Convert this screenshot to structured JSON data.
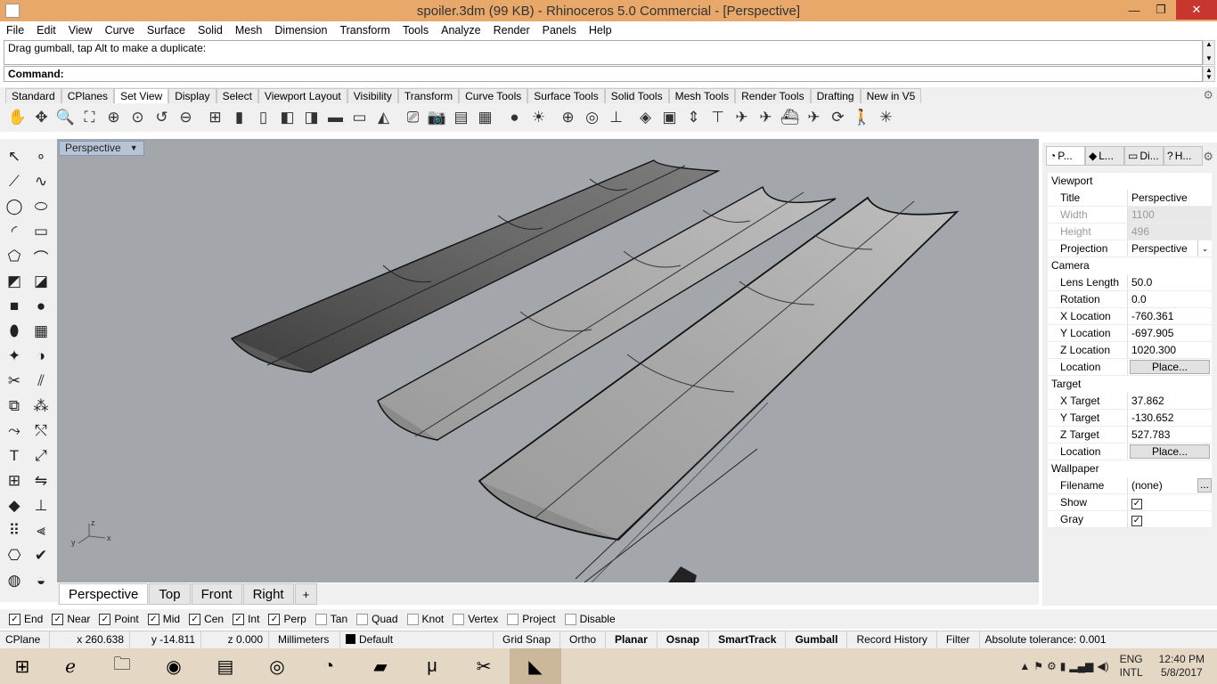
{
  "window": {
    "title": "spoiler.3dm (99 KB) - Rhinoceros 5.0 Commercial - [Perspective]"
  },
  "menu": [
    "File",
    "Edit",
    "View",
    "Curve",
    "Surface",
    "Solid",
    "Mesh",
    "Dimension",
    "Transform",
    "Tools",
    "Analyze",
    "Render",
    "Panels",
    "Help"
  ],
  "command": {
    "history": "Drag gumball, tap Alt to make a duplicate:",
    "prompt": "Command:"
  },
  "toolbar_tabs": [
    "Standard",
    "CPlanes",
    "Set View",
    "Display",
    "Select",
    "Viewport Layout",
    "Visibility",
    "Transform",
    "Curve Tools",
    "Surface Tools",
    "Solid Tools",
    "Mesh Tools",
    "Render Tools",
    "Drafting",
    "New in V5"
  ],
  "toolbar_icons": [
    "pan-icon",
    "rotate-view-icon",
    "zoom-icon",
    "zoom-window-icon",
    "zoom-extents-icon",
    "zoom-selected-icon",
    "undo-view-icon",
    "zoom-out-icon",
    "four-view-icon",
    "top-view-icon",
    "bottom-view-icon",
    "left-view-icon",
    "right-view-icon",
    "front-view-icon",
    "back-view-icon",
    "perspective-view-icon",
    "set-camera-icon",
    "camera-icon",
    "named-view-icon",
    "named-position-icon",
    "sphere-view-icon",
    "sun-icon",
    "target-icon",
    "target-gumball-icon",
    "cplane-icon",
    "view-cube-icon",
    "box-view-icon",
    "elevator-icon",
    "stand-icon",
    "airplane-icon",
    "plane-icon",
    "ship-icon",
    "plane-alt-icon",
    "rotate-icon",
    "walk-icon",
    "explode-icon"
  ],
  "left_icons": [
    "select-icon",
    "point-icon",
    "polyline-icon",
    "curve-icon",
    "circle-icon",
    "ellipse-icon",
    "arc-icon",
    "rectangle-icon",
    "polygon-icon",
    "fillet-curve-icon",
    "surface-icon",
    "surface-patch-icon",
    "box-icon",
    "sphere-icon",
    "extrude-icon",
    "mesh-icon",
    "lights-icon",
    "boolean-icon",
    "trim-icon",
    "split-icon",
    "group-icon",
    "explode-solid-icon",
    "offset-icon",
    "blend-icon",
    "text-icon",
    "scale-icon",
    "array-icon",
    "mirror-icon",
    "solid-tools-icon",
    "dimension-icon",
    "grid-icon",
    "align-icon",
    "analyze-icon",
    "check-icon",
    "render-icon",
    "material-icon"
  ],
  "viewport": {
    "label": "Perspective",
    "axes": [
      "z",
      "y",
      "x"
    ]
  },
  "viewport_tabs": [
    "Perspective",
    "Top",
    "Front",
    "Right",
    "+"
  ],
  "panel": {
    "tabs": [
      {
        "label": "P...",
        "icon": "properties-icon"
      },
      {
        "label": "L...",
        "icon": "layers-icon"
      },
      {
        "label": "Di...",
        "icon": "display-icon"
      },
      {
        "label": "H...",
        "icon": "help-icon"
      }
    ],
    "sections": [
      {
        "title": "Viewport",
        "rows": [
          {
            "key": "Title",
            "value": "Perspective"
          },
          {
            "key": "Width",
            "value": "1100",
            "disabled": true
          },
          {
            "key": "Height",
            "value": "496",
            "disabled": true
          },
          {
            "key": "Projection",
            "value": "Perspective",
            "dropdown": true
          }
        ]
      },
      {
        "title": "Camera",
        "rows": [
          {
            "key": "Lens Length",
            "value": "50.0"
          },
          {
            "key": "Rotation",
            "value": "0.0"
          },
          {
            "key": "X Location",
            "value": "-760.361"
          },
          {
            "key": "Y Location",
            "value": "-697.905"
          },
          {
            "key": "Z Location",
            "value": "1020.300"
          },
          {
            "key": "Location",
            "value": "Place...",
            "button": true
          }
        ]
      },
      {
        "title": "Target",
        "rows": [
          {
            "key": "X Target",
            "value": "37.862"
          },
          {
            "key": "Y Target",
            "value": "-130.652"
          },
          {
            "key": "Z Target",
            "value": "527.783"
          },
          {
            "key": "Location",
            "value": "Place...",
            "button": true
          }
        ]
      },
      {
        "title": "Wallpaper",
        "rows": [
          {
            "key": "Filename",
            "value": "(none)",
            "dots": "..."
          },
          {
            "key": "Show",
            "value": "✓",
            "check": true
          },
          {
            "key": "Gray",
            "value": "✓",
            "check": true
          }
        ]
      }
    ]
  },
  "osnaps": [
    {
      "label": "End",
      "checked": true
    },
    {
      "label": "Near",
      "checked": true
    },
    {
      "label": "Point",
      "checked": true
    },
    {
      "label": "Mid",
      "checked": true
    },
    {
      "label": "Cen",
      "checked": true
    },
    {
      "label": "Int",
      "checked": true
    },
    {
      "label": "Perp",
      "checked": true
    },
    {
      "label": "Tan",
      "checked": false
    },
    {
      "label": "Quad",
      "checked": false
    },
    {
      "label": "Knot",
      "checked": false
    },
    {
      "label": "Vertex",
      "checked": false
    },
    {
      "label": "Project",
      "checked": false
    },
    {
      "label": "Disable",
      "checked": false
    }
  ],
  "status": {
    "cplane": "CPlane",
    "x": "x 260.638",
    "y": "y -14.811",
    "z": "z 0.000",
    "units": "Millimeters",
    "layer": "Default",
    "toggles": [
      {
        "label": "Grid Snap",
        "bold": false
      },
      {
        "label": "Ortho",
        "bold": false
      },
      {
        "label": "Planar",
        "bold": true
      },
      {
        "label": "Osnap",
        "bold": true
      },
      {
        "label": "SmartTrack",
        "bold": true
      },
      {
        "label": "Gumball",
        "bold": true
      },
      {
        "label": "Record History",
        "bold": false
      },
      {
        "label": "Filter",
        "bold": false
      }
    ],
    "tolerance": "Absolute tolerance: 0.001"
  },
  "taskbar": {
    "apps": [
      "windows-start-icon",
      "internet-explorer-icon",
      "file-explorer-icon",
      "chrome-icon",
      "store-icon",
      "app-icon",
      "firefox-icon",
      "sticky-notes-icon",
      "utorrent-icon",
      "snipping-tool-icon",
      "rhino-icon"
    ],
    "lang": [
      "ENG",
      "INTL"
    ],
    "time": "12:40 PM",
    "date": "5/8/2017"
  },
  "colors": {
    "titlebar": "#e8a86a",
    "viewport_bg": "#a3a7ac",
    "close": "#c7372f"
  }
}
